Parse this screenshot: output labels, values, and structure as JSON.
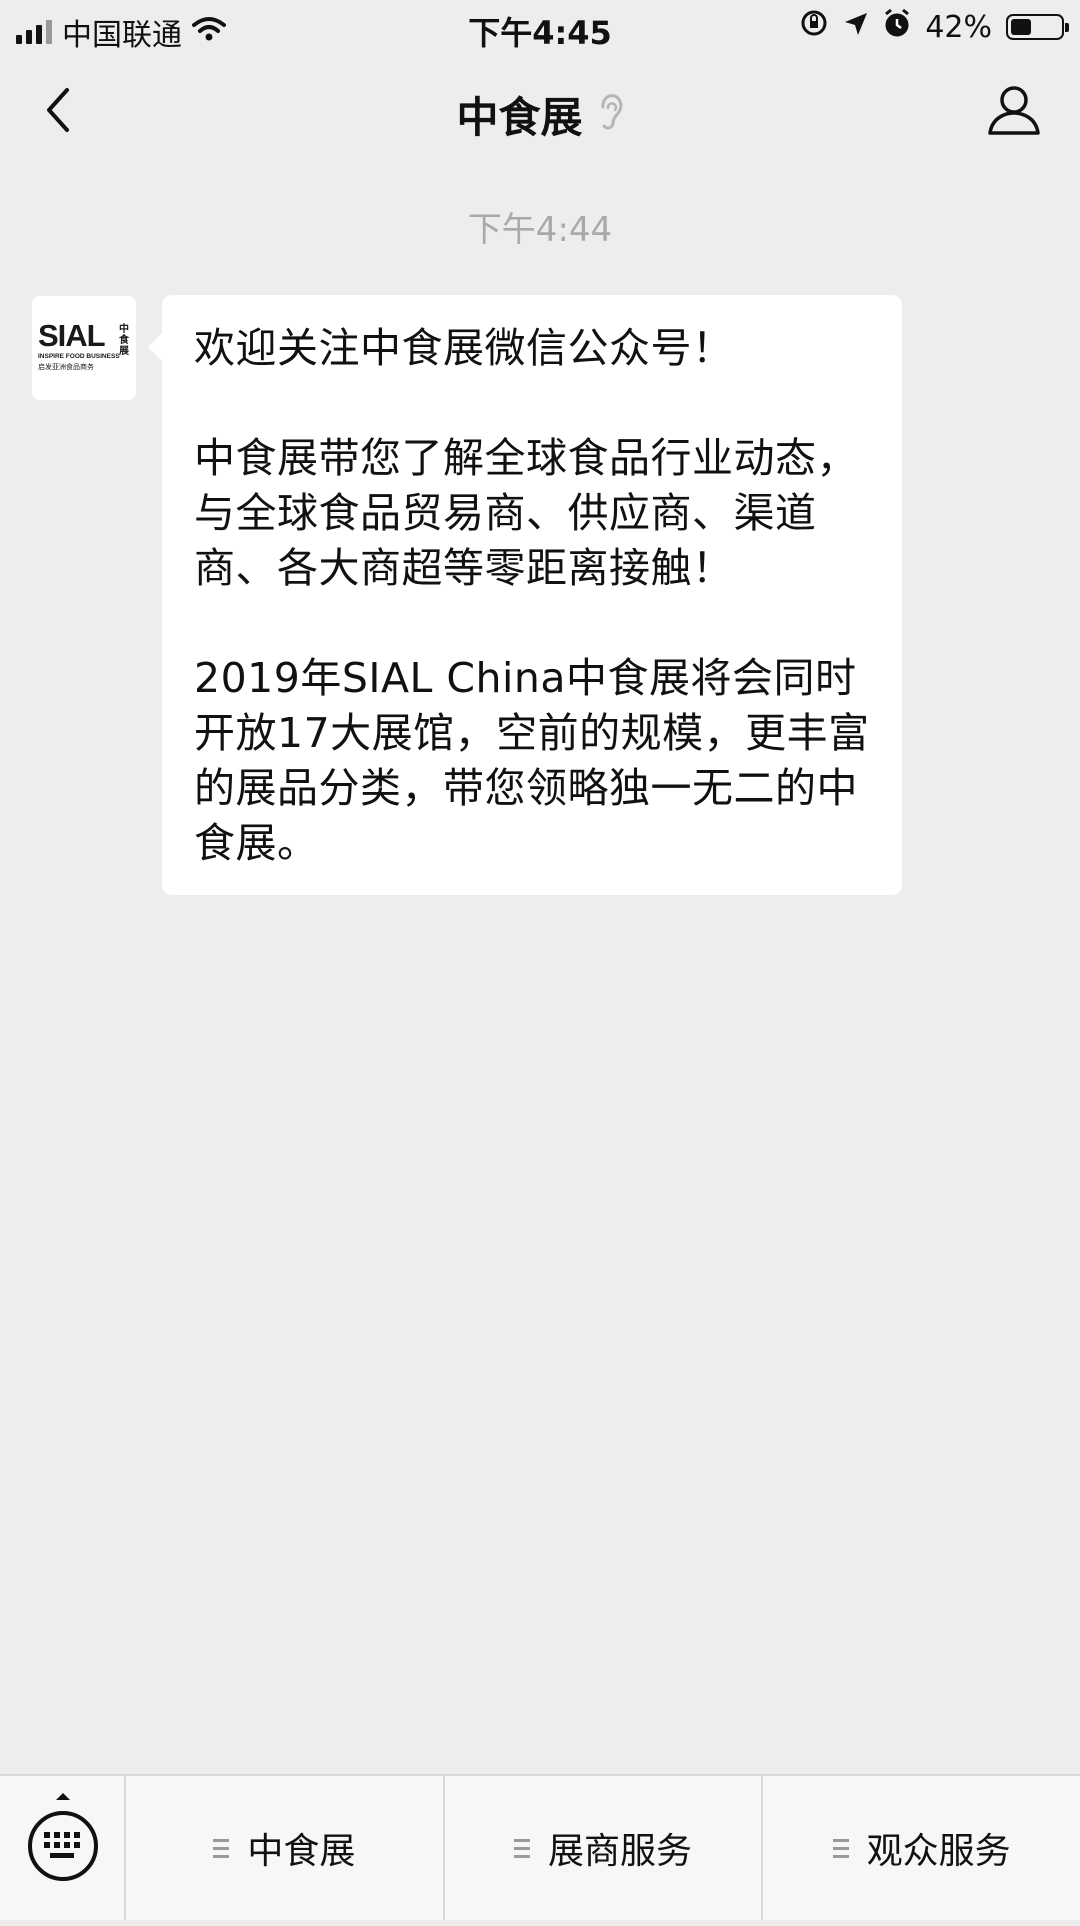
{
  "status_bar": {
    "carrier": "中国联通",
    "time": "下午4:45",
    "battery_text": "42%",
    "battery_level": 0.42,
    "icons": [
      "signal-icon",
      "wifi-icon",
      "orientation-lock-icon",
      "location-arrow-icon",
      "alarm-icon",
      "battery-icon"
    ]
  },
  "nav": {
    "title": "中食展",
    "icons": [
      "back-chevron-icon",
      "ear-icon",
      "profile-icon"
    ]
  },
  "chat": {
    "timestamp": "下午4:44",
    "avatar": {
      "logo_text": "SIAL",
      "logo_cn": "中食展",
      "tagline": "INSPIRE FOOD BUSINESS",
      "tagline_cn": "启发亚洲食品商务"
    },
    "message": {
      "paragraphs": [
        "欢迎关注中食展微信公众号！",
        "中食展带您了解全球食品行业动态，与全球食品贸易商、供应商、渠道商、各大商超等零距离接触！",
        "2019年SIAL China中食展将会同时开放17大展馆，空前的规模，更丰富的展品分类，带您领略独一无二的中食展。"
      ]
    }
  },
  "bottom_menu": {
    "keyboard_icon": "keyboard-icon",
    "items": [
      {
        "label": "中食展"
      },
      {
        "label": "展商服务"
      },
      {
        "label": "观众服务"
      }
    ]
  },
  "colors": {
    "background": "#ededed",
    "bubble": "#ffffff",
    "timestamp": "#a9a9a9",
    "menu_bg": "#f7f7f7"
  }
}
